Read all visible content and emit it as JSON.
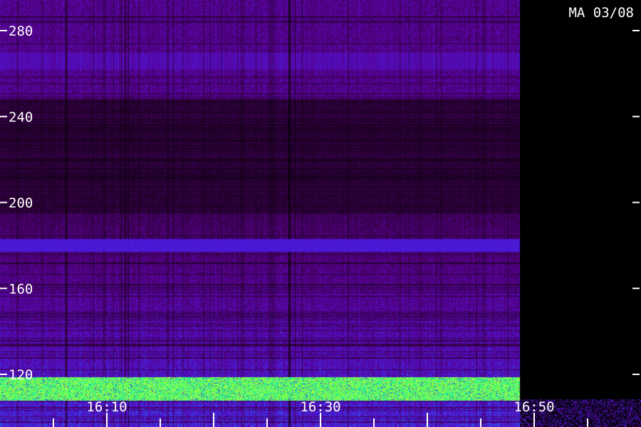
{
  "chart_data": {
    "type": "heatmap",
    "title": "MA 03/08",
    "xlabel": "",
    "ylabel": "",
    "y_ticks": [
      280,
      240,
      200,
      160,
      120
    ],
    "y_range": [
      108,
      293
    ],
    "x_ticks": [
      "16:10",
      "16:30",
      "16:50"
    ],
    "x_range_minutes": [
      "16:02",
      "16:58"
    ],
    "data_end_time": "16:50",
    "features": [
      {
        "kind": "constant-band",
        "y_from": 177,
        "y_to": 183,
        "intensity": "high"
      },
      {
        "kind": "broad-band",
        "y_from": 262,
        "y_to": 270,
        "intensity": "medium"
      },
      {
        "kind": "strong-band",
        "y_from": 108,
        "y_to": 119,
        "intensity": "very-high"
      }
    ],
    "colorscale": [
      "#000000",
      "#2a0035",
      "#5a0090",
      "#4a18d8",
      "#2a60ff",
      "#00e0d0",
      "#60ff40",
      "#ffff40"
    ]
  }
}
